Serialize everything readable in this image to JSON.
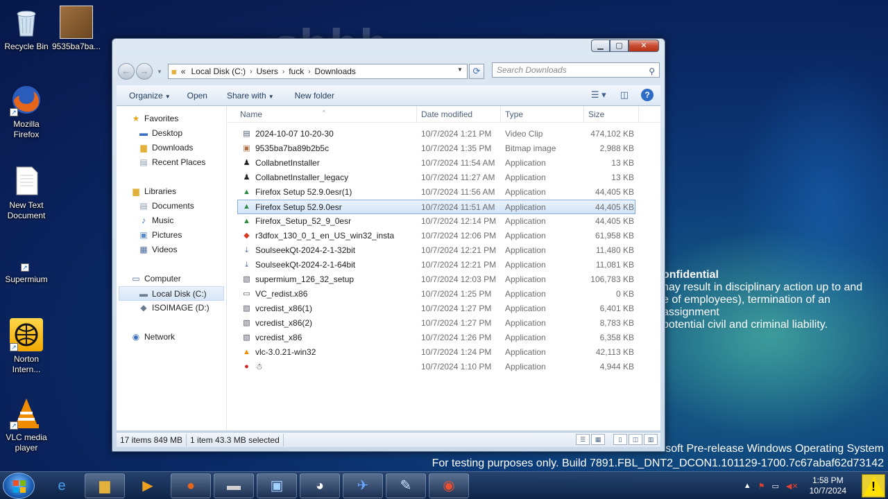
{
  "desktop": {
    "background_text": "shhh...",
    "icons": [
      {
        "label": "Recycle Bin",
        "icon": "recycle-bin-icon"
      },
      {
        "label": "9535ba7ba...",
        "icon": "cat-image-icon"
      },
      {
        "label": "Mozilla Firefox",
        "icon": "firefox-icon"
      },
      {
        "label": "New Text Document",
        "icon": "text-document-icon"
      },
      {
        "label": "Supermium",
        "icon": "supermium-icon"
      },
      {
        "label": "Norton Intern...",
        "icon": "norton-icon"
      },
      {
        "label": "VLC media player",
        "icon": "vlc-icon"
      }
    ],
    "confidential": {
      "title": "onfidential",
      "line1": "nay result in disciplinary action up to and",
      "line2": "e of employees), termination of an assignment",
      "line3": "potential civil and criminal liability."
    },
    "watermark": {
      "line1": "Microsoft Pre-release Windows Operating System",
      "line2": "For testing purposes only. Build 7891.FBL_DNT2_DCON1.101129-1700.7c67abaf62d73142"
    }
  },
  "explorer": {
    "breadcrumb": {
      "overflow": "«",
      "segments": [
        "Local Disk (C:)",
        "Users",
        "fuck",
        "Downloads"
      ]
    },
    "search_placeholder": "Search Downloads",
    "toolbar": {
      "organize": "Organize",
      "open": "Open",
      "share_with": "Share with",
      "new_folder": "New folder"
    },
    "nav": {
      "favorites": "Favorites",
      "desktop": "Desktop",
      "downloads": "Downloads",
      "recent_places": "Recent Places",
      "libraries": "Libraries",
      "documents": "Documents",
      "music": "Music",
      "pictures": "Pictures",
      "videos": "Videos",
      "computer": "Computer",
      "local_disk": "Local Disk (C:)",
      "isoimage": "ISOIMAGE (D:)",
      "network": "Network"
    },
    "columns": {
      "name": "Name",
      "date": "Date modified",
      "type": "Type",
      "size": "Size"
    },
    "files": [
      {
        "name": "2024-10-07 10-20-30",
        "date": "10/7/2024 1:21 PM",
        "type": "Video Clip",
        "size": "474,102 KB",
        "icon": "video-file-icon"
      },
      {
        "name": "9535ba7ba89b2b5c",
        "date": "10/7/2024 1:35 PM",
        "type": "Bitmap image",
        "size": "2,988 KB",
        "icon": "bitmap-file-icon"
      },
      {
        "name": "CollabnetInstaller",
        "date": "10/7/2024 11:54 AM",
        "type": "Application",
        "size": "13 KB",
        "icon": "installer-icon"
      },
      {
        "name": "CollabnetInstaller_legacy",
        "date": "10/7/2024 11:27 AM",
        "type": "Application",
        "size": "13 KB",
        "icon": "installer-icon"
      },
      {
        "name": "Firefox Setup 52.9.0esr(1)",
        "date": "10/7/2024 11:56 AM",
        "type": "Application",
        "size": "44,405 KB",
        "icon": "setup-icon"
      },
      {
        "name": "Firefox Setup 52.9.0esr",
        "date": "10/7/2024 11:51 AM",
        "type": "Application",
        "size": "44,405 KB",
        "icon": "setup-icon"
      },
      {
        "name": "Firefox_Setup_52_9_0esr",
        "date": "10/7/2024 12:14 PM",
        "type": "Application",
        "size": "44,405 KB",
        "icon": "setup-icon"
      },
      {
        "name": "r3dfox_130_0_1_en_US_win32_insta",
        "date": "10/7/2024 12:06 PM",
        "type": "Application",
        "size": "61,958 KB",
        "icon": "r3dfox-icon"
      },
      {
        "name": "SoulseekQt-2024-2-1-32bit",
        "date": "10/7/2024 12:21 PM",
        "type": "Application",
        "size": "11,480 KB",
        "icon": "download-app-icon"
      },
      {
        "name": "SoulseekQt-2024-2-1-64bit",
        "date": "10/7/2024 12:21 PM",
        "type": "Application",
        "size": "11,081 KB",
        "icon": "download-app-icon"
      },
      {
        "name": "supermium_126_32_setup",
        "date": "10/7/2024 12:03 PM",
        "type": "Application",
        "size": "106,783 KB",
        "icon": "setup-box-icon"
      },
      {
        "name": "VC_redist.x86",
        "date": "10/7/2024 1:25 PM",
        "type": "Application",
        "size": "0 KB",
        "icon": "blank-app-icon"
      },
      {
        "name": "vcredist_x86(1)",
        "date": "10/7/2024 1:27 PM",
        "type": "Application",
        "size": "6,401 KB",
        "icon": "setup-box-icon"
      },
      {
        "name": "vcredist_x86(2)",
        "date": "10/7/2024 1:27 PM",
        "type": "Application",
        "size": "8,783 KB",
        "icon": "setup-box-icon"
      },
      {
        "name": "vcredist_x86",
        "date": "10/7/2024 1:26 PM",
        "type": "Application",
        "size": "6,358 KB",
        "icon": "setup-box-icon"
      },
      {
        "name": "vlc-3.0.21-win32",
        "date": "10/7/2024 1:24 PM",
        "type": "Application",
        "size": "42,113 KB",
        "icon": "vlc-icon"
      },
      {
        "name": "☃",
        "date": "10/7/2024 1:10 PM",
        "type": "Application",
        "size": "4,944 KB",
        "icon": "red-apple-icon"
      }
    ],
    "selected_index": 5,
    "status": {
      "count": "17 items 849 MB",
      "selection": "1 item 43.3 MB selected"
    }
  },
  "taskbar": {
    "apps": [
      "internet-explorer-icon",
      "explorer-folder-icon",
      "media-player-icon",
      "firefox-icon",
      "drive-icon",
      "control-panel-icon",
      "panda-icon",
      "bird-icon",
      "paint-icon",
      "r3dfox-icon"
    ],
    "clock_time": "1:58 PM",
    "clock_date": "10/7/2024"
  },
  "colors": {
    "accent": "#2f6cc6",
    "selection": "#d3e4f8",
    "desktop": "#0d3e7a"
  }
}
